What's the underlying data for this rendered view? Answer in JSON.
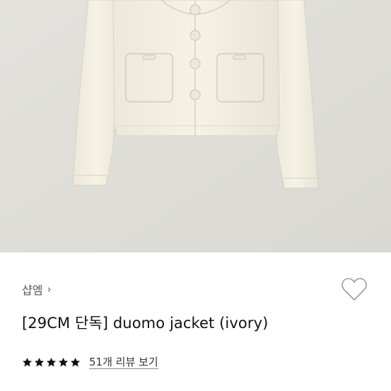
{
  "product": {
    "brand": "샵엠",
    "brand_chevron": "›",
    "title": "[29CM 단독] duomo jacket (ivory)",
    "rating": 5,
    "review_link": "51개 리뷰 보기"
  },
  "icons": {
    "wishlist": "heart-outline-icon",
    "star": "star-filled-icon",
    "chevron": "chevron-right-icon"
  },
  "colors": {
    "photo_bg": "#deddd8",
    "jacket": "#f1eee1",
    "star": "#111111"
  }
}
